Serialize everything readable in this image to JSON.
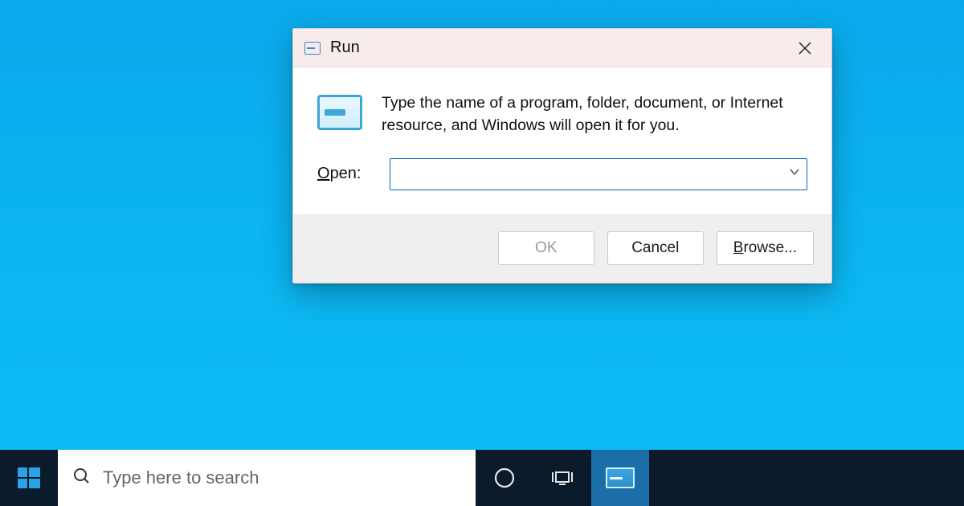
{
  "dialog": {
    "title": "Run",
    "description": "Type the name of a program, folder, document, or Internet resource, and Windows will open it for you.",
    "open_label_pre": "O",
    "open_label_rest": "pen:",
    "open_value": "",
    "buttons": {
      "ok": "OK",
      "cancel": "Cancel",
      "browse_pre": "B",
      "browse_rest": "rowse..."
    }
  },
  "taskbar": {
    "search_placeholder": "Type here to search"
  }
}
